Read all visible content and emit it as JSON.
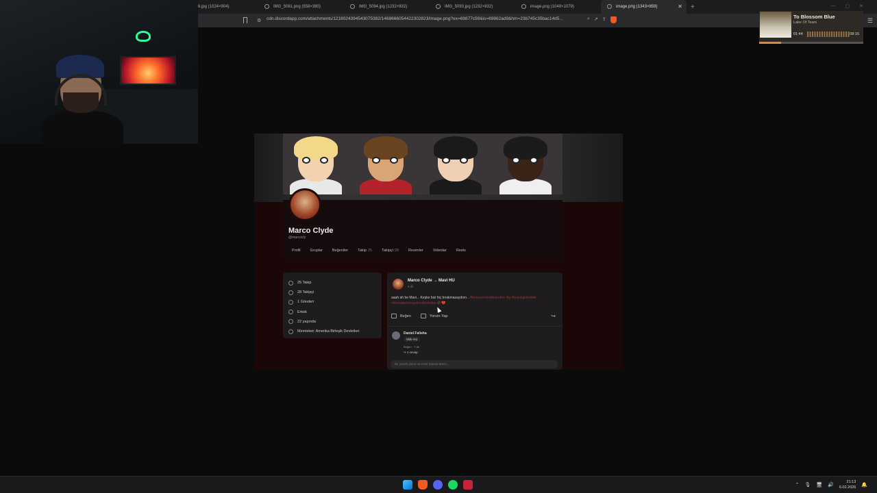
{
  "browser": {
    "tabs": [
      {
        "label": "6.jpg (1024×904)"
      },
      {
        "label": "IMG_5081.png (558×380)"
      },
      {
        "label": "IMG_5094.jpg (1232×832)"
      },
      {
        "label": "IMG_5093.jpg (1232×832)"
      },
      {
        "label": "image.png (1049×1079)"
      },
      {
        "label": "image.png (1343×859)",
        "active": true
      }
    ],
    "new_tab": "+",
    "url": "cdn.discordapp.com/attachments/1218024394543075382/1468666054422302823/image.png?ex=69877c59&is=69862ad9&hm=23b745c35bac14d5..."
  },
  "media": {
    "title": "To Blossom Blue",
    "artist": "Lake Of Tears",
    "elapsed": "01:44",
    "total": "08:15",
    "progress": 0.21
  },
  "profile": {
    "name": "Marco Clyde",
    "handle": "@marcocly",
    "tabs": [
      {
        "label": "Profil"
      },
      {
        "label": "Gruplar"
      },
      {
        "label": "Beğeniler"
      },
      {
        "label": "Takip",
        "count": "25"
      },
      {
        "label": "Takipçi",
        "count": "28"
      },
      {
        "label": "Resimler"
      },
      {
        "label": "Videolar"
      },
      {
        "label": "Reels"
      }
    ]
  },
  "info": [
    {
      "label": "25 Takip",
      "icon": "user-icon"
    },
    {
      "label": "28 Takipçi",
      "icon": "users-icon"
    },
    {
      "label": "1 Gönderi",
      "icon": "post-icon"
    },
    {
      "label": "Erkek",
      "icon": "gender-icon"
    },
    {
      "label": "22 yaşında",
      "icon": "cake-icon"
    },
    {
      "label": "Memleket: Amerika Birleşik Devletleri",
      "icon": "globe-icon"
    }
  ],
  "post": {
    "author": "Marco Clyde → Mavi HU",
    "time": "8 dk",
    "text": "aaah ah be Mavi... Keşke bizi hiç bırakmasaydınn..",
    "tags": "#benceseninaklınerdeo #ig #buyukglobaldai #imonabelsengelmedenhobip",
    "emoji": "🥀💔",
    "like": "Beğen",
    "comment": "Yorum Yap",
    "comments": [
      {
        "name": "Daniel Falisha",
        "text": "öldü mü",
        "meta": "Beğen · 7 dk",
        "replies": "↪ 1 cevap"
      }
    ],
    "comment_placeholder": "Bir yorum yazın ve enter tuşuna basın..."
  },
  "taskbar": {
    "time": "21:13",
    "date": "6.02.2026"
  }
}
